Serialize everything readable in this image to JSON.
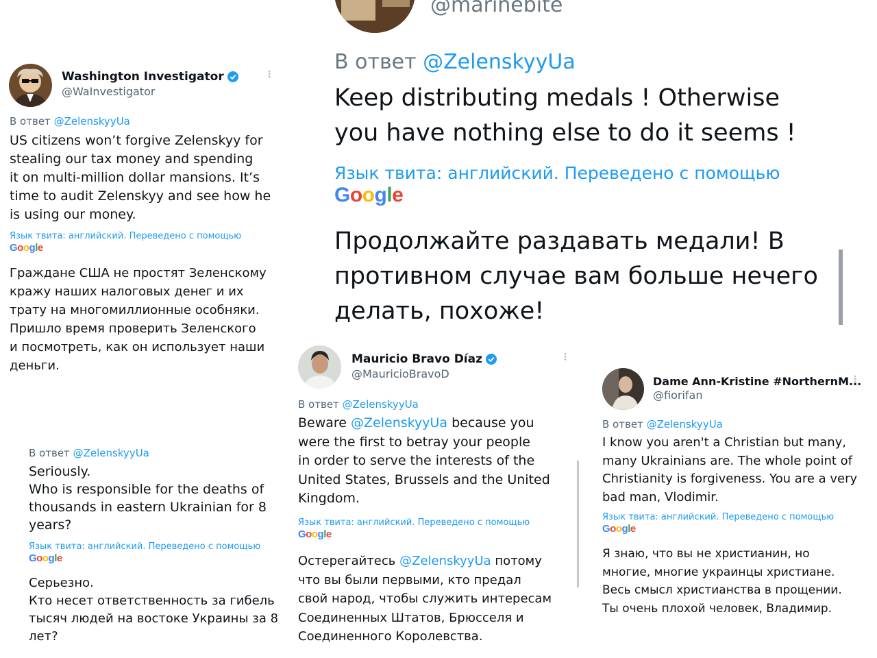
{
  "reply_prefix": "В ответ",
  "translate_notice": "Язык твита: английский. Переведено с помощью",
  "google": [
    "G",
    "o",
    "o",
    "g",
    "l",
    "e"
  ],
  "tweets": {
    "washington": {
      "name": "Washington Investigator",
      "handle": "@WaInvestigator",
      "reply_to": "@ZelenskyyUa",
      "text": [
        "US citizens won’t forgive Zelenskyy for",
        "stealing our tax money and spending",
        "it on multi-million dollar mansions. It’s",
        "time to audit Zelenskyy and see how he",
        "is using our money."
      ],
      "translation": [
        "Граждане США не простят Зеленскому",
        "кражу наших налоговых денег и их",
        "трату на многомиллионные особняки.",
        "Пришло время проверить Зеленского",
        "и посмотреть, как он использует наши",
        "деньги."
      ]
    },
    "marine": {
      "handle": "@marinebite",
      "reply_to": "@ZelenskyyUa",
      "text": [
        "Keep distributing medals ! Otherwise",
        "you have nothing else to do it seems !"
      ],
      "translation": [
        "Продолжайте раздавать медали! В",
        "противном случае вам больше нечего",
        "делать, похоже!"
      ]
    },
    "seriously": {
      "reply_to": "@ZelenskyyUa",
      "text": [
        "Seriously.",
        "Who is responsible for the deaths of",
        "thousands in eastern Ukrainian for 8",
        "years?"
      ],
      "translation": [
        "Серьезно.",
        "Кто несет ответственность за гибель",
        "тысяч людей на востоке Украины за 8",
        "лет?"
      ]
    },
    "mauricio": {
      "name": "Mauricio Bravo Díaz",
      "handle": "@MauricioBravoD",
      "reply_to": "@ZelenskyyUa",
      "text_first": "Beware",
      "text_mention": "@ZelenskyyUa",
      "text_first_rest": "because you",
      "text": [
        "were the first to betray your people",
        "in order to serve the interests of the",
        "United States, Brussels and the United",
        "Kingdom."
      ],
      "translation_first": "Остерегайтесь",
      "translation_mention": "@ZelenskyyUa",
      "translation_first_rest": "потому",
      "translation": [
        "что вы были первыми, кто предал",
        "свой народ, чтобы служить интересам",
        "Соединенных Штатов, Брюсселя и",
        "Соединенного Королевства."
      ]
    },
    "dame": {
      "name": "Dame Ann-Kristine #NorthernM...",
      "handle": "@fiorifan",
      "reply_to": "@ZelenskyyUa",
      "text": [
        "I know you aren't a Christian but many,",
        "many Ukrainians are. The whole point of",
        "Christianity is forgiveness. You are a very",
        "bad man, Vlodimir."
      ],
      "translation": [
        "Я знаю, что вы не христианин, но",
        "многие, многие украинцы христиане.",
        "Весь смысл христианства в прощении.",
        "Ты очень плохой человек, Владимир."
      ]
    }
  }
}
